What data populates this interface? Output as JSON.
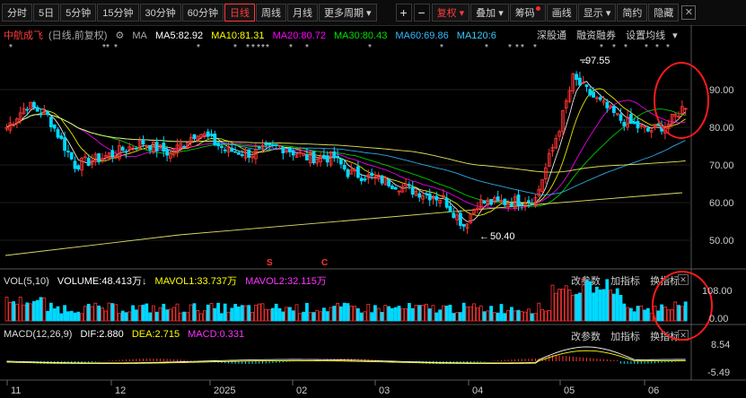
{
  "toolbar": {
    "periods": [
      "分时",
      "5日",
      "5分钟",
      "15分钟",
      "30分钟",
      "60分钟",
      "日线",
      "周线",
      "月线",
      "更多周期"
    ],
    "active_period": "日线",
    "fuquan": "复权",
    "overlay": "叠加",
    "chips": "筹码",
    "draw": "画线",
    "display": "显示",
    "simple": "简约",
    "hide": "隐藏"
  },
  "legend": {
    "stock": "中航成飞",
    "mode": "(日线,前复权)",
    "ma_label": "MA",
    "ma5": "MA5:82.92",
    "ma10": "MA10:81.31",
    "ma20": "MA20:80.72",
    "ma30": "MA30:80.43",
    "ma60": "MA60:69.86",
    "ma120": "MA120:6",
    "sh_link": "深股通",
    "margin": "融资融券",
    "set_ma": "设置均线"
  },
  "price_axis": [
    "90.00",
    "80.00",
    "70.00",
    "60.00",
    "50.00"
  ],
  "annotations": {
    "high": "97.55",
    "low": "50.40"
  },
  "volume": {
    "label": "VOL(5,10)",
    "volume": "VOLUME:48.413万",
    "mavol1": "MAVOL1:33.737万",
    "mavol2": "MAVOL2:32.115万",
    "axis": [
      "108.00",
      "0.00"
    ]
  },
  "macd": {
    "label": "MACD(12,26,9)",
    "dif": "DIF:2.880",
    "dea": "DEA:2.715",
    "macd": "MACD:0.331",
    "axis": [
      "8.54",
      "-5.49"
    ]
  },
  "panel_tools": {
    "params": "改参数",
    "add": "加指标",
    "switch": "换指标"
  },
  "xaxis": [
    "11",
    "12",
    "2025",
    "02",
    "03",
    "04",
    "05",
    "06"
  ],
  "markers": [
    "S",
    "C"
  ],
  "colors": {
    "up": "#ff3333",
    "down": "#00d8ff",
    "ma5": "#ffffff",
    "ma10": "#ffff00",
    "ma20": "#ff00ff",
    "ma30": "#00e000",
    "ma60": "#33bbff",
    "ma120": "#ffff66",
    "active": "#ff3b3b"
  }
}
